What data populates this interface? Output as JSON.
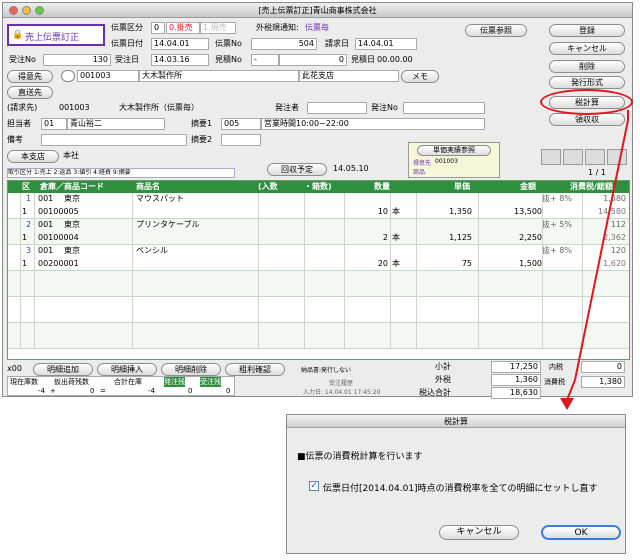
{
  "window": {
    "title": "[売上伝票訂正]青山商事株式会社"
  },
  "mode_badge": "売上伝票訂正",
  "header": {
    "denpyo_kubun_label": "伝票区分",
    "denpyo_kubun_value": "0",
    "kake_label": "0.掛売",
    "genkin_label": "1.現売",
    "tax_notice_label": "外税規通知:",
    "tax_notice_value": "伝票毎",
    "denpyo_date_label": "伝票日付",
    "denpyo_date_value": "14.04.01",
    "denpyo_no_label": "伝票No",
    "denpyo_no_value": "504",
    "seikyu_date_label": "請求日",
    "seikyu_date_value": "14.04.01",
    "juchu_no_label": "受注No",
    "juchu_no_value": "130",
    "juchu_date_label": "受注日",
    "juchu_date_value": "14.03.16",
    "mitsumori_no_label": "見積No",
    "mitsumori_no_value": "-",
    "mitsumori_no_value2": "0",
    "mitsumori_date_label": "見積日",
    "mitsumori_date_value": "00.00.00",
    "tokuisaki_button": "得意先",
    "tokuisaki_code": "001003",
    "tokuisaki_name": "大木製作所",
    "tokuisaki_branch": "此花支店",
    "memo_button": "メモ",
    "chokuso_button": "直送先",
    "seikyusaki_label": "(請求先)",
    "seikyusaki_code": "001003",
    "seikyusaki_name": "大木製作所（伝票毎）",
    "hatchusha_label": "発注者",
    "hatchu_no_label": "発注No",
    "tantosha_label": "担当者",
    "tantosha_code": "01",
    "tantosha_name": "青山裕二",
    "tekiyo1_label": "摘要1",
    "tekiyo1_code": "005",
    "tekiyo1_text": "営業時間10:00~22:00",
    "biko_label": "備考",
    "tekiyo2_label": "摘要2",
    "honshiten_button": "本支店",
    "honshiten_value": "本社",
    "kaishu_button": "回収予定",
    "kaishu_date": "14.05.10",
    "tanka_button": "単価実績参照",
    "tanka_code_label": "得意先",
    "tanka_code": "001003",
    "tanka_item_label": "商品",
    "torihiki_label": "取引区分",
    "torihiki_options": "1:売上 2:返品 3:値引 4:経費 9:摘要"
  },
  "buttons": {
    "denpyo_sansho": "伝票参照",
    "toroku": "登録",
    "cancel": "キャンセル",
    "sakujo": "削除",
    "hakko": "発行形式",
    "zeikeisan": "税計算",
    "ryoshu": "領収収"
  },
  "page_indicator": "1 / 1",
  "grid": {
    "headers": {
      "ku": "区",
      "soko": "倉庫／商品コード",
      "shohin": "商品名",
      "irisu": "(入数",
      "hakosu": "・箱数)",
      "suryo": "数量",
      "tanka": "単価",
      "kingaku": "金額",
      "zei": "消費税/総額"
    },
    "rows": [
      {
        "no": "1",
        "kubun": "1",
        "soko_code": "001",
        "soko_name": "東京",
        "item_code": "00100005",
        "item_name": "マウスパット",
        "qty": "10",
        "unit": "本",
        "price": "1,350",
        "amount": "13,500",
        "tax_rate": "抜+ 8%",
        "tax": "1,080",
        "total": "14,580"
      },
      {
        "no": "2",
        "kubun": "1",
        "soko_code": "001",
        "soko_name": "東京",
        "item_code": "00100004",
        "item_name": "プリンタケーブル",
        "qty": "2",
        "unit": "本",
        "price": "1,125",
        "amount": "2,250",
        "tax_rate": "抜+ 5%",
        "tax": "112",
        "total": "2,362"
      },
      {
        "no": "3",
        "kubun": "1",
        "soko_code": "001",
        "soko_name": "東京",
        "item_code": "00200001",
        "item_name": "ペンシル",
        "qty": "20",
        "unit": "本",
        "price": "75",
        "amount": "1,500",
        "tax_rate": "抜+ 8%",
        "tax": "120",
        "total": "1,620"
      }
    ]
  },
  "footer": {
    "row_count": "x00",
    "meisai_tsuika": "明細追加",
    "meisai_sonyu": "明細挿入",
    "meisai_sakujo": "明細削除",
    "arari_kakunin": "粗利確認",
    "shohin_hakko": "納品書:発行しない",
    "shokei_label": "小計",
    "shokei_value": "17,250",
    "gaizei_label": "外税",
    "gaizei_value": "1,360",
    "zeikomi_label": "税込合計",
    "zeikomi_value": "18,630",
    "naizei_label": "内税",
    "naizei_value": "0",
    "shohizei_label": "消費税",
    "shohizei_value": "1,380",
    "zaiko_label": "現在庫数",
    "karidashi_label": "仮出荷残数",
    "gokei_label": "合計在庫",
    "hatchu_zan_label": "発注残",
    "juchu_zan_label": "受注残",
    "zaiko_value": "-4",
    "karidashi_value": "0",
    "gokei_value": "-4",
    "hatchu_zan_value": "0",
    "juchu_zan_value": "0",
    "juchu_kaisha": "受注履歴",
    "nyuryoku_date": "入力日: 14.04.01 17:45:20"
  },
  "dialog": {
    "title": "税計算",
    "heading": "■伝票の消費税計算を行います",
    "checkbox_label": "伝票日付[2014.04.01]時点の消費税率を全ての明細にセットし直す",
    "checkbox_checked": true,
    "cancel": "キャンセル",
    "ok": "OK"
  },
  "colors": {
    "header_green": "#2f8f3f",
    "highlight_red": "#e0161d",
    "purple_badge": "#6a2fb0"
  }
}
